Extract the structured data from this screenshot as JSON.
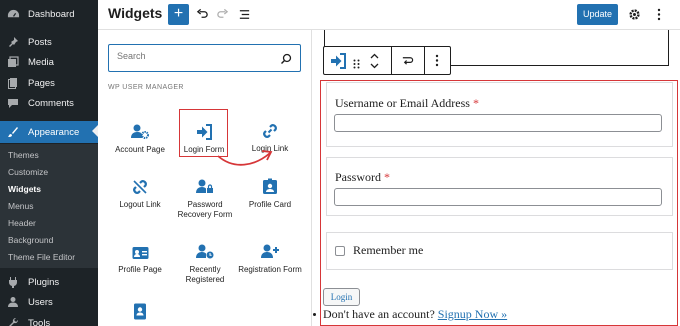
{
  "sidebar": {
    "items": [
      {
        "label": "Dashboard",
        "icon": "dashboard-icon"
      },
      {
        "label": "Posts",
        "icon": "pin-icon"
      },
      {
        "label": "Media",
        "icon": "media-icon"
      },
      {
        "label": "Pages",
        "icon": "pages-icon"
      },
      {
        "label": "Comments",
        "icon": "comment-icon"
      },
      {
        "label": "Appearance",
        "icon": "brush-icon"
      },
      {
        "label": "Plugins",
        "icon": "plugin-icon"
      },
      {
        "label": "Users",
        "icon": "users-icon"
      },
      {
        "label": "Tools",
        "icon": "tools-icon"
      }
    ],
    "submenu": [
      "Themes",
      "Customize",
      "Widgets",
      "Menus",
      "Header",
      "Background",
      "Theme File Editor"
    ],
    "current_sub": "Widgets",
    "active": "Appearance"
  },
  "header": {
    "title": "Widgets",
    "add_label": "+",
    "update_label": "Update"
  },
  "inserter": {
    "search_placeholder": "Search",
    "category": "WP USER MANAGER",
    "blocks": [
      {
        "label": "Account Page",
        "icon": "user-gear-icon"
      },
      {
        "label": "Login Form",
        "icon": "sign-in-icon"
      },
      {
        "label": "Login Link",
        "icon": "link-icon"
      },
      {
        "label": "Logout Link",
        "icon": "unlink-icon"
      },
      {
        "label": "Password Recovery Form",
        "icon": "user-lock-icon"
      },
      {
        "label": "Profile Card",
        "icon": "id-card-icon"
      },
      {
        "label": "Profile Page",
        "icon": "id-badge-icon"
      },
      {
        "label": "Recently Registered",
        "icon": "user-clock-icon"
      },
      {
        "label": "Registration Form",
        "icon": "user-plus-icon"
      },
      {
        "label": "",
        "icon": "address-book-icon"
      }
    ]
  },
  "form": {
    "username_label": "Username or Email Address",
    "password_label": "Password",
    "required_mark": "*",
    "remember_label": "Remember me",
    "login_label": "Login",
    "signup_prompt": "Don't have an account?",
    "signup_link": "Signup Now »"
  },
  "colors": {
    "accent": "#2271b1",
    "highlight": "#d63638",
    "sidebar_bg": "#1d2327"
  }
}
